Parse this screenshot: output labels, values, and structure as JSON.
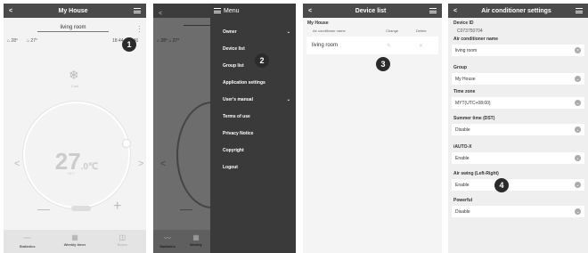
{
  "screen1": {
    "title": "My House",
    "room": "living room",
    "indoor": "28°",
    "outdoor": "27°",
    "time": "18:44 / 16:46",
    "mode": "Cool",
    "temp": "27",
    "temp_dec": ".0",
    "temp_unit": "℃",
    "set_label": "SET",
    "nav": [
      {
        "label": "Statistics",
        "icon": "chart-icon"
      },
      {
        "label": "Weekly timer",
        "icon": "calendar-icon"
      },
      {
        "label": "Room",
        "icon": "room-icon"
      }
    ],
    "callout": "1"
  },
  "screen2": {
    "menu_title": "Menu",
    "items": [
      "Owner",
      "Device list",
      "Group list",
      "Application settings",
      "User's manual",
      "Terms of use",
      "Privacy Notice",
      "Copyright",
      "Logout"
    ],
    "nav": [
      "Statistics",
      "Weekly"
    ],
    "callout": "2"
  },
  "screen3": {
    "title": "Device list",
    "group": "My House",
    "col_name": "Air conditioner name",
    "col_change": "Change",
    "col_delete": "Delete",
    "device": "living room",
    "callout": "3"
  },
  "screen4": {
    "title": "Air conditioner settings",
    "device_id_label": "Device ID",
    "device_id": "C073750704",
    "name_label": "Air conditioner name",
    "name_value": "living room",
    "group_label": "Group",
    "group_value": "My House",
    "tz_label": "Time zone",
    "tz_value": "MYT(UTC+08:00)",
    "dst_label": "Summer time (DST)",
    "dst_value": "Disable",
    "iauto_label": "iAUTO-X",
    "iauto_value": "Enable",
    "swing_label": "Air swing (Left-Right)",
    "swing_value": "Enable",
    "powerful_label": "Powerful",
    "powerful_value": "Disable",
    "callout": "4"
  }
}
